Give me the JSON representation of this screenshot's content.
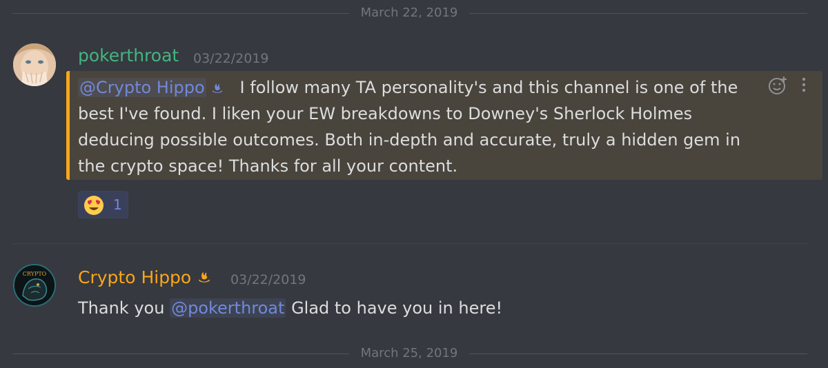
{
  "dividers": [
    "March 22, 2019",
    "March 25, 2019"
  ],
  "messages": [
    {
      "author": "pokerthroat",
      "timestamp": "03/22/2019",
      "mention": "@Crypto Hippo",
      "text": "I follow many TA personality's and this channel is one of the best I've found.  I liken your EW breakdowns to Downey's Sherlock Holmes deducing possible outcomes.  Both in-depth and accurate, truly a hidden gem in the crypto space! Thanks for all your content.",
      "reaction": {
        "emoji": "heart-eyes-emoji",
        "count": "1"
      }
    },
    {
      "author": "Crypto Hippo",
      "timestamp": "03/22/2019",
      "text_before": "Thank you",
      "mention": "@pokerthroat",
      "text_after": "Glad to have you in here!",
      "avatar_text": "CRYPTO"
    }
  ],
  "colors": {
    "background": "#36393f",
    "highlight": "#49443c",
    "highlight_border": "#faa61a",
    "user1": "#43b581",
    "user2": "#faa61a",
    "mention": "#7289da",
    "timestamp": "#72767d"
  }
}
